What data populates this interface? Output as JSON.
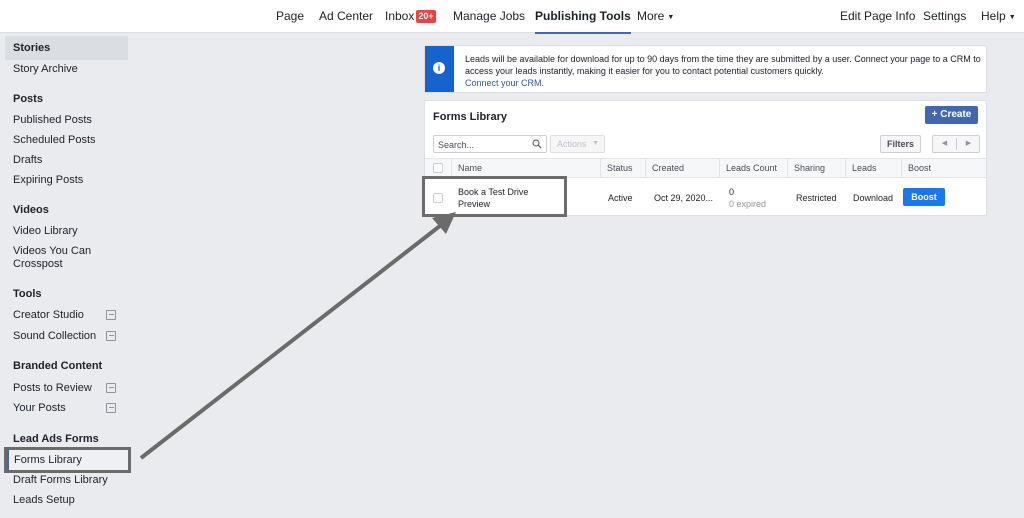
{
  "topnav": {
    "page": "Page",
    "ad_center": "Ad Center",
    "inbox": "Inbox",
    "inbox_badge": "20+",
    "manage_jobs": "Manage Jobs",
    "publishing_tools": "Publishing Tools",
    "more": "More",
    "edit_page_info": "Edit Page Info",
    "settings": "Settings",
    "help": "Help"
  },
  "sidebar": {
    "stories": "Stories",
    "story_archive": "Story Archive",
    "posts_head": "Posts",
    "published_posts": "Published Posts",
    "scheduled_posts": "Scheduled Posts",
    "drafts": "Drafts",
    "expiring_posts": "Expiring Posts",
    "videos_head": "Videos",
    "video_library": "Video Library",
    "videos_crosspost": "Videos You Can Crosspost",
    "tools_head": "Tools",
    "creator_studio": "Creator Studio",
    "sound_collection": "Sound Collection",
    "branded_head": "Branded Content",
    "posts_to_review": "Posts to Review",
    "your_posts": "Your Posts",
    "lead_ads_head": "Lead Ads Forms",
    "forms_library": "Forms Library",
    "draft_forms_library": "Draft Forms Library",
    "leads_setup": "Leads Setup"
  },
  "info": {
    "text": "Leads will be available for download for up to 90 days from the time they are submitted by a user. Connect your page to a CRM to access your leads instantly, making it easier for you to contact potential customers quickly.",
    "link": "Connect your CRM."
  },
  "forms": {
    "title": "Forms Library",
    "create": "+ Create",
    "search_placeholder": "Search...",
    "actions": "Actions",
    "filters": "Filters",
    "columns": [
      "Name",
      "Status",
      "Created",
      "Leads Count",
      "Sharing",
      "Leads",
      "Boost"
    ],
    "row": {
      "name": "Book a Test Drive",
      "preview": "Preview",
      "status": "Active",
      "created": "Oct 29, 2020...",
      "leads_count": "0",
      "expired": "0 expired",
      "sharing": "Restricted",
      "leads": "Download",
      "boost": "Boost"
    }
  },
  "colors": {
    "brand_blue": "#4267b2",
    "boost_blue": "#1877f2",
    "info_blue": "#1463cf",
    "badge_red": "#fa3e3e",
    "highlight_gray": "#6b6b6b"
  }
}
